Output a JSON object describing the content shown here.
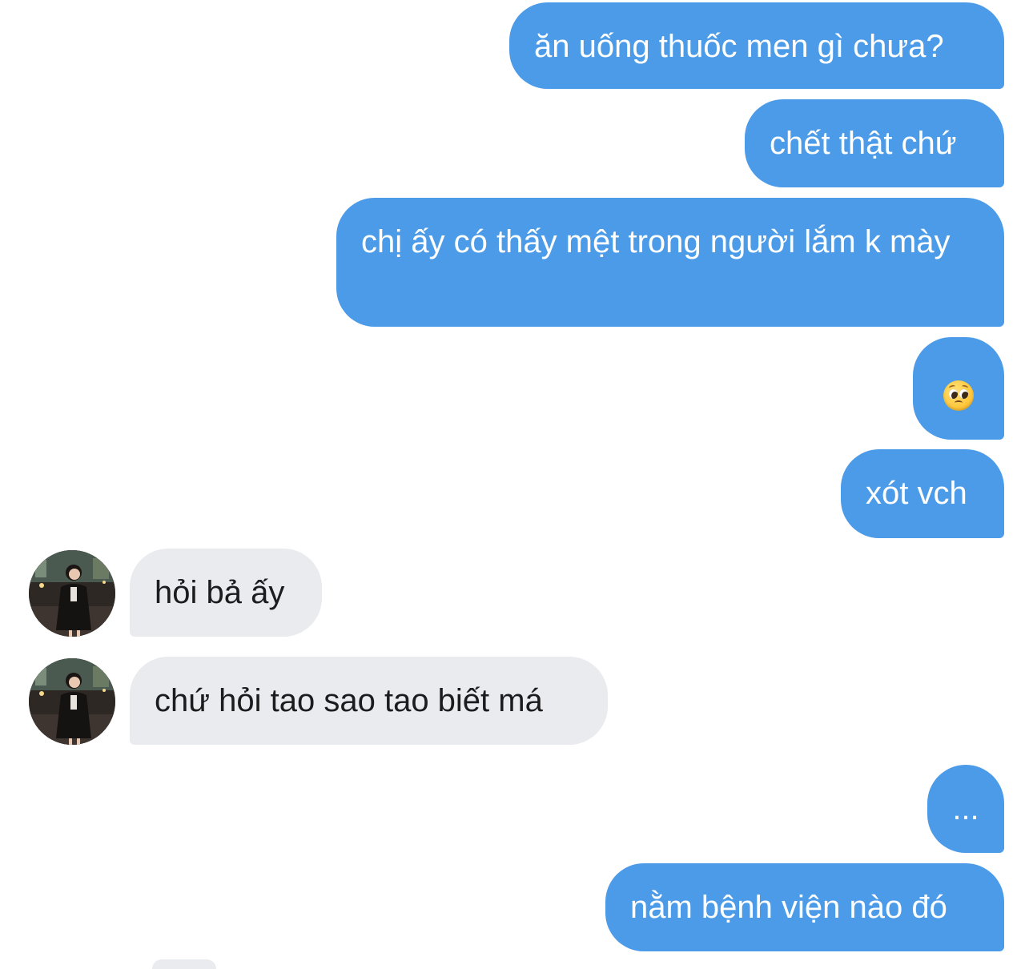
{
  "messages": [
    {
      "side": "sent",
      "text": "ăn uống thuốc men gì chưa?"
    },
    {
      "side": "sent",
      "text": "chết thật chứ"
    },
    {
      "side": "sent",
      "text": "chị ấy có thấy mệt trong người lắm k mày"
    },
    {
      "side": "sent",
      "text": "🥹",
      "icon": "pleading-face-emoji-icon"
    },
    {
      "side": "sent",
      "text": "xót vch"
    },
    {
      "side": "received",
      "text": "hỏi bả ấy"
    },
    {
      "side": "received",
      "text": "chứ hỏi tao sao tao biết má"
    },
    {
      "side": "sent",
      "text": "..."
    },
    {
      "side": "sent",
      "text": "nằm bệnh viện nào đó"
    }
  ],
  "colors": {
    "sent_bubble": "#4c9be8",
    "received_bubble": "#e9ebef",
    "sent_text": "#ffffff",
    "received_text": "#1c1c1e",
    "background": "#ffffff"
  }
}
